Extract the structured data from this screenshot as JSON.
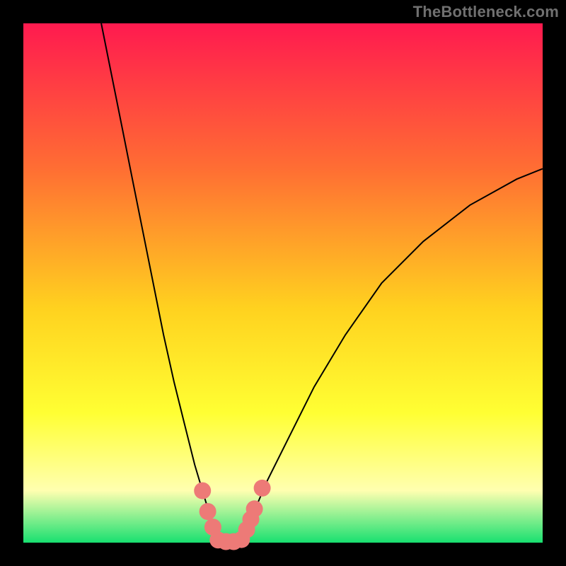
{
  "watermark": "TheBottleneck.com",
  "chart_data": {
    "type": "line",
    "title": "",
    "xlabel": "",
    "ylabel": "",
    "xlim": [
      0,
      100
    ],
    "ylim": [
      0,
      100
    ],
    "grid": false,
    "legend": false,
    "background_gradient": {
      "top_color": "#ff1a4f",
      "upper_mid_color": "#ff6e33",
      "mid_color": "#ffd21f",
      "lower_mid_color": "#ffff33",
      "pale_band_color": "#ffffb0",
      "bottom_color": "#18e070"
    },
    "series": [
      {
        "name": "left-branch",
        "color": "#000000",
        "stroke_width": 2,
        "x": [
          15,
          17,
          19,
          21,
          23,
          25,
          27,
          29,
          31,
          33,
          34.5,
          36,
          37.5
        ],
        "y": [
          100,
          90,
          80,
          70,
          60,
          50,
          40,
          31,
          23,
          15,
          10,
          5,
          0
        ]
      },
      {
        "name": "right-branch",
        "color": "#000000",
        "stroke_width": 2,
        "x": [
          42,
          44,
          47,
          51,
          56,
          62,
          69,
          77,
          86,
          95,
          100
        ],
        "y": [
          0,
          5,
          12,
          20,
          30,
          40,
          50,
          58,
          65,
          70,
          72
        ]
      }
    ],
    "highlight_dots": {
      "name": "bottleneck-zone",
      "color": "#ed7a77",
      "radius": 12,
      "points": [
        {
          "x": 34.5,
          "y": 10
        },
        {
          "x": 35.5,
          "y": 6
        },
        {
          "x": 36.5,
          "y": 3
        },
        {
          "x": 37.5,
          "y": 0.5
        },
        {
          "x": 39.0,
          "y": 0.2
        },
        {
          "x": 40.5,
          "y": 0.2
        },
        {
          "x": 42.0,
          "y": 0.6
        },
        {
          "x": 43.0,
          "y": 2.5
        },
        {
          "x": 43.8,
          "y": 4.5
        },
        {
          "x": 44.5,
          "y": 6.5
        },
        {
          "x": 46.0,
          "y": 10.5
        }
      ]
    }
  }
}
